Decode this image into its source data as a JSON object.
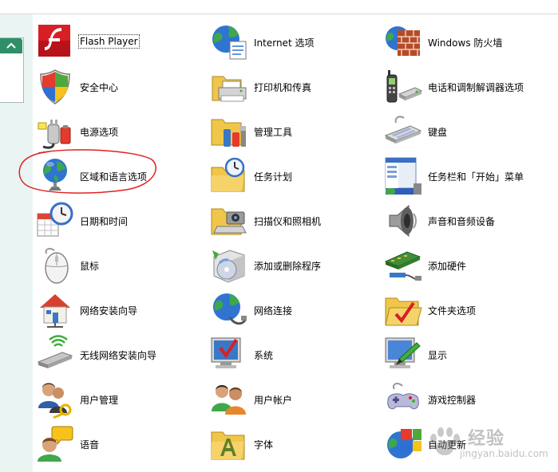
{
  "items": [
    {
      "label": "Flash Player",
      "icon": "flash-player-icon"
    },
    {
      "label": "安全中心",
      "icon": "security-center-icon"
    },
    {
      "label": "电源选项",
      "icon": "power-options-icon"
    },
    {
      "label": "区域和语言选项",
      "icon": "regional-language-icon"
    },
    {
      "label": "日期和时间",
      "icon": "date-time-icon"
    },
    {
      "label": "鼠标",
      "icon": "mouse-icon"
    },
    {
      "label": "网络安装向导",
      "icon": "network-setup-icon"
    },
    {
      "label": "无线网络安装向导",
      "icon": "wireless-setup-icon"
    },
    {
      "label": "用户管理",
      "icon": "user-manage-icon"
    },
    {
      "label": "语音",
      "icon": "speech-icon"
    },
    {
      "label": "Internet 选项",
      "icon": "internet-options-icon"
    },
    {
      "label": "打印机和传真",
      "icon": "printer-fax-icon"
    },
    {
      "label": "管理工具",
      "icon": "admin-tools-icon"
    },
    {
      "label": "任务计划",
      "icon": "scheduled-tasks-icon"
    },
    {
      "label": "扫描仪和照相机",
      "icon": "scanner-camera-icon"
    },
    {
      "label": "添加或删除程序",
      "icon": "add-remove-programs-icon"
    },
    {
      "label": "网络连接",
      "icon": "network-connections-icon"
    },
    {
      "label": "系统",
      "icon": "system-icon"
    },
    {
      "label": "用户帐户",
      "icon": "user-accounts-icon"
    },
    {
      "label": "字体",
      "icon": "fonts-icon"
    },
    {
      "label": "Windows 防火墙",
      "icon": "firewall-icon"
    },
    {
      "label": "电话和调制解调器选项",
      "icon": "phone-modem-icon"
    },
    {
      "label": "键盘",
      "icon": "keyboard-icon"
    },
    {
      "label": "任务栏和「开始」菜单",
      "icon": "taskbar-start-icon"
    },
    {
      "label": "声音和音频设备",
      "icon": "sound-audio-icon"
    },
    {
      "label": "添加硬件",
      "icon": "add-hardware-icon"
    },
    {
      "label": "文件夹选项",
      "icon": "folder-options-icon"
    },
    {
      "label": "显示",
      "icon": "display-icon"
    },
    {
      "label": "游戏控制器",
      "icon": "game-controller-icon"
    },
    {
      "label": "自动更新",
      "icon": "automatic-updates-icon"
    }
  ],
  "selected_item": "Flash Player",
  "watermark": {
    "brand": "经验",
    "url": "jingyan.baidu.com"
  },
  "colors": {
    "pane": "#eaf5f3",
    "collapse": "#2f8f68",
    "annotation": "#e02020"
  }
}
